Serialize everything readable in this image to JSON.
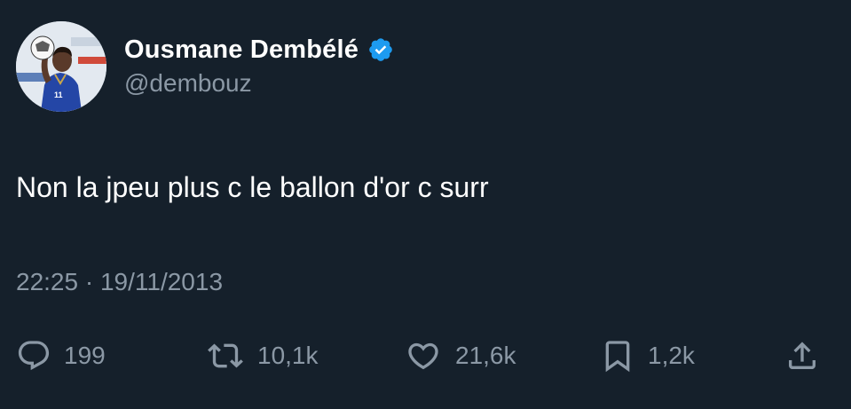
{
  "user": {
    "display_name": "Ousmane Dembélé",
    "handle": "@dembouz",
    "verified": true,
    "avatar_jersey_number": "11"
  },
  "tweet": {
    "text": "Non la jpeu plus c le ballon d'or c surr",
    "timestamp": "22:25 · 19/11/2013"
  },
  "actions": {
    "reply": {
      "icon": "reply-bubble-icon",
      "count": "199"
    },
    "retweet": {
      "icon": "retweet-icon",
      "count": "10,1k"
    },
    "like": {
      "icon": "heart-icon",
      "count": "21,6k"
    },
    "bookmark": {
      "icon": "bookmark-icon",
      "count": "1,2k"
    },
    "share": {
      "icon": "share-upload-icon"
    }
  },
  "colors": {
    "background": "#15202b",
    "primary_text": "#ffffff",
    "secondary_text": "#8b98a5",
    "verified_badge": "#1d9bf0"
  }
}
